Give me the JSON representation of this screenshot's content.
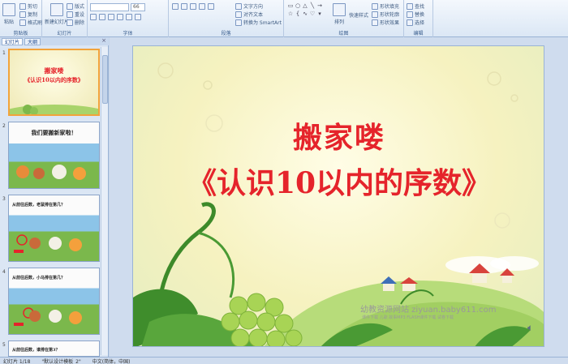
{
  "ribbon": {
    "clipboard": {
      "label": "剪贴板",
      "paste": "粘贴",
      "cut": "剪切",
      "copy": "复制",
      "format": "格式刷"
    },
    "slides": {
      "label": "幻灯片",
      "new_slide": "新建幻灯片",
      "layout": "版式",
      "reset": "重设",
      "delete": "删除"
    },
    "font": {
      "label": "字体",
      "font_name": "",
      "font_size": "66"
    },
    "paragraph": {
      "label": "段落",
      "text_direction": "文字方向",
      "align_text": "对齐文本",
      "smartart": "转换为 SmartArt"
    },
    "drawing": {
      "label": "绘图",
      "arrange": "排列",
      "quick_styles": "快速样式",
      "shape_fill": "形状填充",
      "shape_outline": "形状轮廓",
      "shape_effects": "形状效果"
    },
    "editing": {
      "label": "编辑",
      "find": "查找",
      "replace": "替换",
      "select": "选择"
    }
  },
  "left_panel": {
    "tab_slides": "幻灯片",
    "tab_outline": "大纲",
    "close": "×",
    "thumbnails": [
      {
        "num": "1",
        "line1": "搬家喽",
        "line2": "《认识10以内的序数》"
      },
      {
        "num": "2",
        "line1": "我们要搬新家啦！",
        "line2": ""
      },
      {
        "num": "3",
        "line1": "从前往后数，老鼠排在第几？",
        "line2": ""
      },
      {
        "num": "4",
        "line1": "从前往后数，小马排在第几？",
        "line2": ""
      },
      {
        "num": "5",
        "line1": "从前往后数，谁排在第3？",
        "line2": ""
      }
    ]
  },
  "slide": {
    "title_line1": "搬家喽",
    "title_line2": "《认识10以内的序数》",
    "watermark_main": "幼教资源网站 ziyuan.baby611.com",
    "watermark_sub": "课件下载 儿歌 故事MP3 FLASH课件下载 试卷下载"
  },
  "status": {
    "slide_info": "幻灯片 1/18",
    "theme": "\"默认设计模板_2\"",
    "language": "中文(简体，中国)"
  },
  "colors": {
    "title_red": "#e5242b",
    "selection_orange": "#f2a33b"
  }
}
